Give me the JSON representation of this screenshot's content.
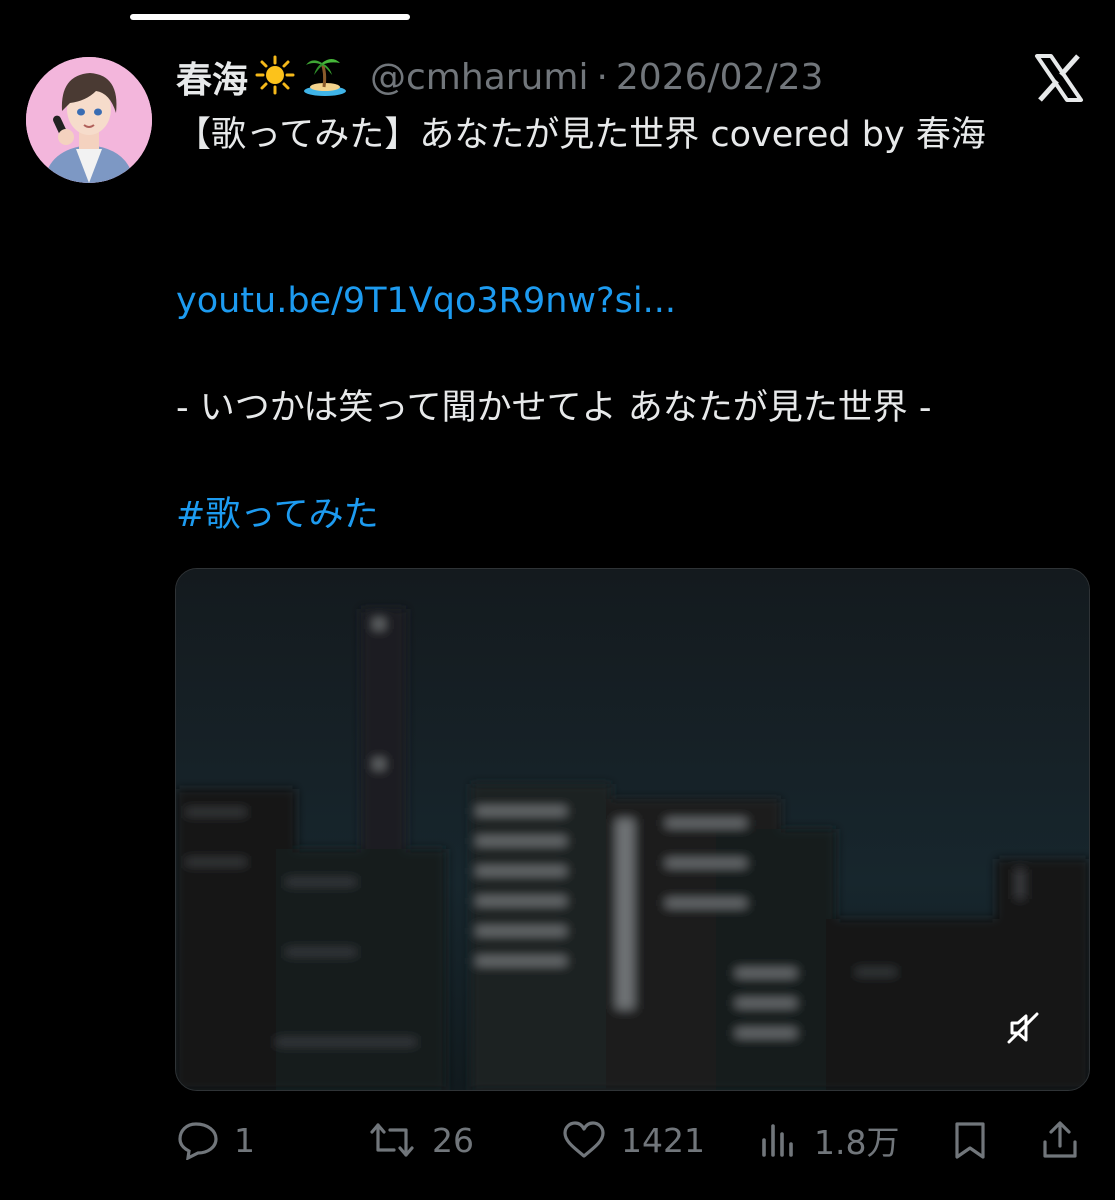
{
  "tweet": {
    "display_name": "春海",
    "handle": "@cmharumi",
    "separator": "·",
    "date": "2026/02/23",
    "body": "【歌ってみた】あなたが見た世界 covered by 春海",
    "link": "youtu.be/9T1Vqo3R9nw?si...",
    "lyric": "- いつかは笑って聞かせてよ あなたが見た世界 -",
    "hashtag": "#歌ってみた"
  },
  "actions": {
    "replies": "1",
    "reposts": "26",
    "likes": "1421",
    "views": "1.8万"
  },
  "icons": [
    "sun-emoji-icon",
    "palm-island-emoji-icon",
    "x-logo-icon",
    "mute-icon",
    "reply-icon",
    "repost-icon",
    "like-icon",
    "views-icon",
    "bookmark-icon",
    "share-icon"
  ],
  "colors": {
    "background": "#000000",
    "text": "#e7e9ea",
    "muted": "#71767b",
    "link": "#1d9bf0"
  }
}
